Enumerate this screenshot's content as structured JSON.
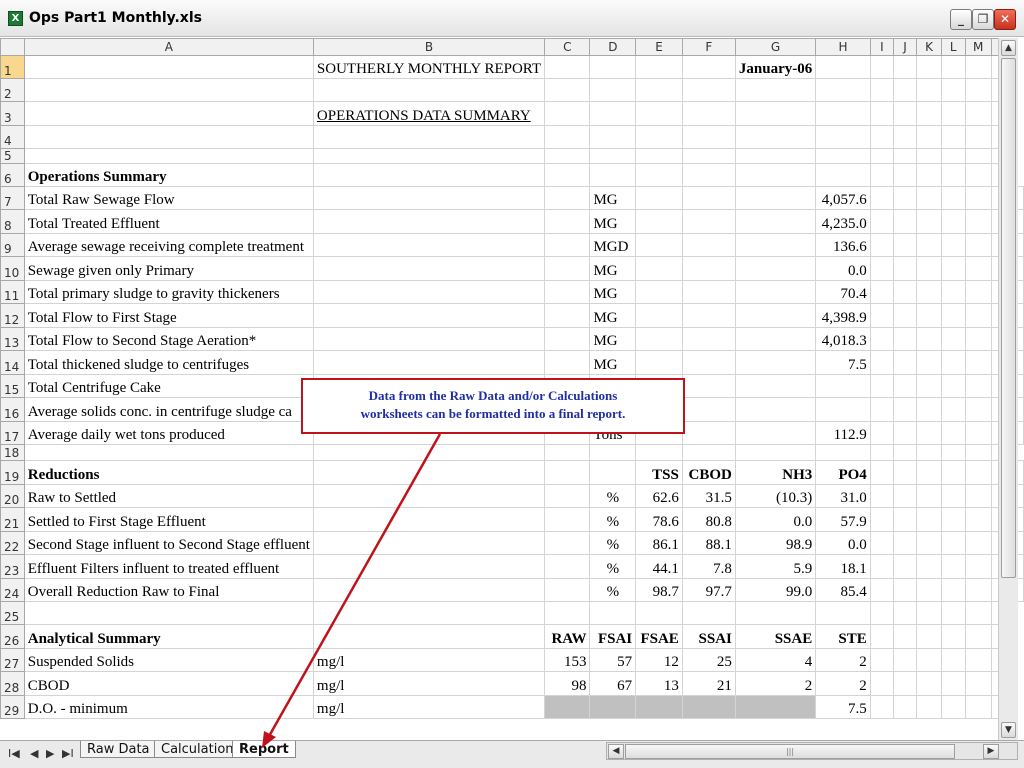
{
  "window": {
    "title": "Ops Part1 Monthly.xls",
    "icon": "excel-workbook-icon",
    "minimize": "_",
    "restore": "❐",
    "close": "✕"
  },
  "columns": [
    "A",
    "B",
    "C",
    "D",
    "E",
    "F",
    "G",
    "H",
    "I",
    "J",
    "K",
    "L",
    "M",
    "N"
  ],
  "rows": {
    "n": [
      "1",
      "2",
      "3",
      "4",
      "5",
      "6",
      "7",
      "8",
      "9",
      "10",
      "11",
      "12",
      "13",
      "14",
      "15",
      "16",
      "17",
      "18",
      "19",
      "20",
      "21",
      "22",
      "23",
      "24",
      "25",
      "26",
      "27",
      "28",
      "29"
    ],
    "r1": {
      "title": "SOUTHERLY  MONTHLY REPORT",
      "month": "January-06"
    },
    "r3": {
      "heading": "OPERATIONS DATA SUMMARY"
    },
    "r6": {
      "section": "Operations Summary"
    },
    "ops": [
      {
        "label": "Total Raw Sewage Flow",
        "unit": "MG",
        "value": "4,057.6"
      },
      {
        "label": "Total Treated Effluent",
        "unit": "MG",
        "value": "4,235.0"
      },
      {
        "label": "Average sewage receiving complete treatment",
        "unit": "MGD",
        "value": "136.6"
      },
      {
        "label": "Sewage given only Primary",
        "unit": "MG",
        "value": "0.0"
      },
      {
        "label": "Total primary sludge to gravity thickeners",
        "unit": "MG",
        "value": "70.4"
      },
      {
        "label": "Total Flow to First Stage",
        "unit": "MG",
        "value": "4,398.9"
      },
      {
        "label": "Total Flow to Second Stage Aeration*",
        "unit": "MG",
        "value": "4,018.3"
      },
      {
        "label": "Total thickened sludge to centrifuges",
        "unit": "MG",
        "value": "7.5"
      },
      {
        "label": "Total Centrifuge Cake",
        "unit": "",
        "value": ""
      },
      {
        "label": "Average  solids conc. in centrifuge sludge ca",
        "unit": "",
        "value": ""
      },
      {
        "label": "Average daily wet tons produced",
        "unit": "Tons",
        "value": "112.9"
      }
    ],
    "r19": {
      "section": "Reductions",
      "h1": "TSS",
      "h2": "CBOD",
      "h3": "NH3",
      "h4": "PO4"
    },
    "reductions": [
      {
        "label": "Raw to Settled",
        "unit": "%",
        "tss": "62.6",
        "cbod": "31.5",
        "nh3": "(10.3)",
        "po4": "31.0"
      },
      {
        "label": "Settled to First Stage Effluent",
        "unit": "%",
        "tss": "78.6",
        "cbod": "80.8",
        "nh3": "0.0",
        "po4": "57.9"
      },
      {
        "label": "Second Stage influent to Second Stage effluent",
        "unit": "%",
        "tss": "86.1",
        "cbod": "88.1",
        "nh3": "98.9",
        "po4": "0.0"
      },
      {
        "label": "Effluent Filters influent to treated effluent",
        "unit": "%",
        "tss": "44.1",
        "cbod": "7.8",
        "nh3": "5.9",
        "po4": "18.1"
      },
      {
        "label": "Overall Reduction Raw to Final",
        "unit": "%",
        "tss": "98.7",
        "cbod": "97.7",
        "nh3": "99.0",
        "po4": "85.4"
      }
    ],
    "r26": {
      "section": "Analytical Summary",
      "h1": "RAW",
      "h2": "FSAI",
      "h3": "FSAE",
      "h4": "SSAI",
      "h5": "SSAE",
      "h6": "STE"
    },
    "analytical": [
      {
        "label": "Suspended Solids",
        "unit": "mg/l",
        "raw": "153",
        "fsai": "57",
        "fsae": "12",
        "ssai": "25",
        "ssae": "4",
        "ste": "2"
      },
      {
        "label": "CBOD",
        "unit": "mg/l",
        "raw": "98",
        "fsai": "67",
        "fsae": "13",
        "ssai": "21",
        "ssae": "2",
        "ste": "2"
      },
      {
        "label": "D.O. - minimum",
        "unit": "mg/l",
        "raw": "",
        "fsai": "",
        "fsae": "",
        "ssai": "",
        "ssae": "",
        "ste": "7.5"
      }
    ]
  },
  "callout": {
    "line1": "Data from the Raw Data and/or Calculations",
    "line2": "worksheets can be formatted into a final report.",
    "border_color": "#c0121b",
    "text_color": "#1f2ea6"
  },
  "tabs": {
    "nav_first": "I◀",
    "nav_prev": "◀",
    "nav_next": "▶",
    "nav_last": "▶I",
    "items": [
      {
        "label": "Raw Data",
        "active": false
      },
      {
        "label": "Calculations",
        "active": false
      },
      {
        "label": "Report",
        "active": true
      }
    ]
  },
  "scroll": {
    "up": "▲",
    "down": "▼",
    "left": "◀",
    "right": "▶",
    "grip": "|||"
  }
}
